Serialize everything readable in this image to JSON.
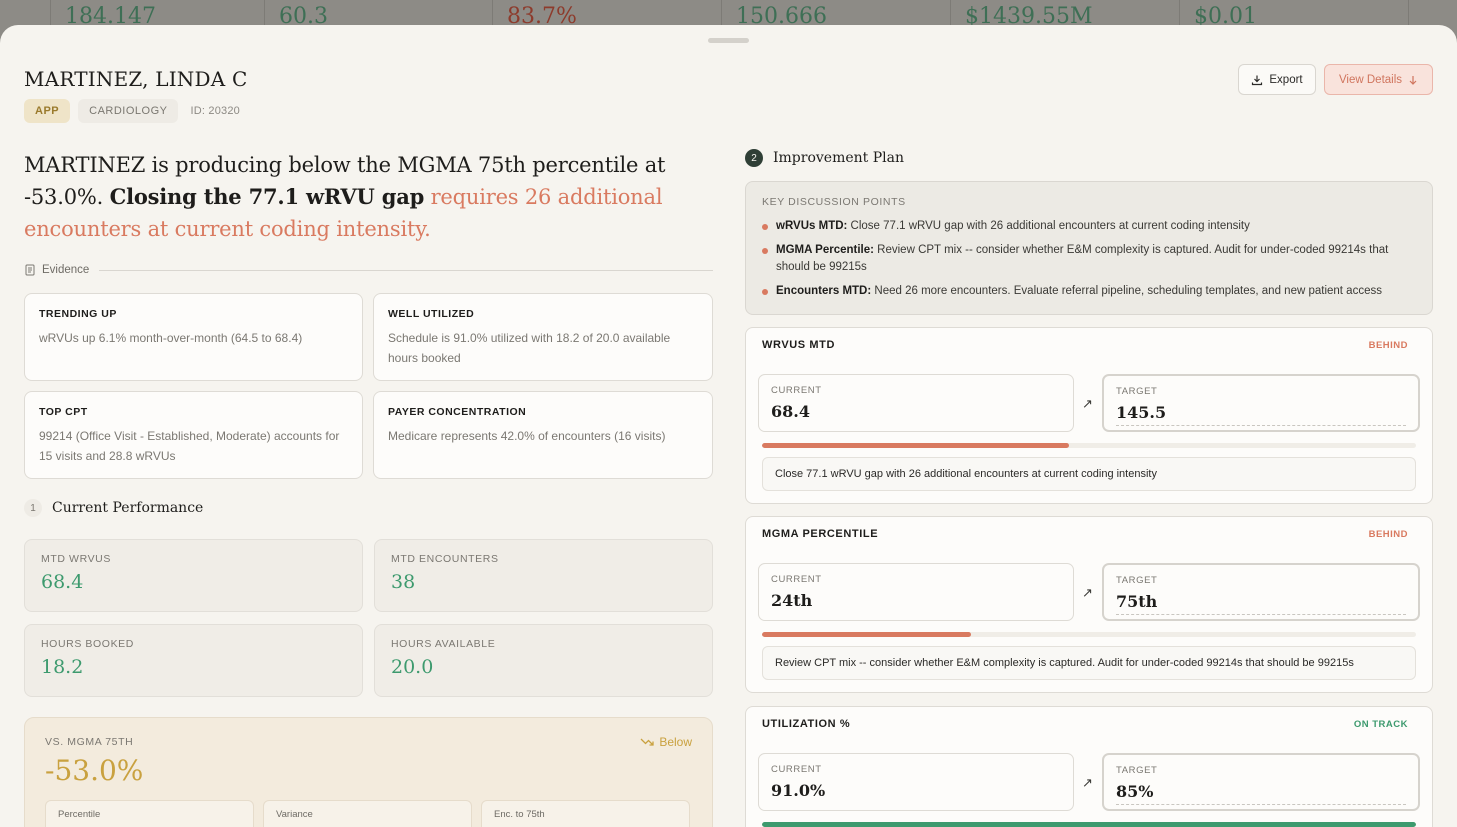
{
  "background_strip": {
    "values": [
      "184.147",
      "60.3",
      "83.7%",
      "150.666",
      "$1439.55M",
      "$0.01"
    ]
  },
  "header": {
    "name": "MARTINEZ, LINDA C",
    "tag_type": "APP",
    "tag_specialty": "CARDIOLOGY",
    "id_label": "ID: 20320",
    "export_label": "Export",
    "view_details_label": "View Details"
  },
  "headline": {
    "part1": "MARTINEZ is producing below the MGMA 75th percentile at -53.0%. ",
    "part2_bold": "Closing the 77.1 wRVU gap",
    "part3_accent": " requires 26 additional encounters at current coding intensity."
  },
  "evidence": {
    "label": "Evidence",
    "cards": [
      {
        "title": "TRENDING UP",
        "text": "wRVUs up 6.1% month-over-month (64.5 to 68.4)"
      },
      {
        "title": "WELL UTILIZED",
        "text": "Schedule is 91.0% utilized with 18.2 of 20.0 available hours booked"
      },
      {
        "title": "TOP CPT",
        "text": "99214 (Office Visit - Established, Moderate) accounts for 15 visits and 28.8 wRVUs"
      },
      {
        "title": "PAYER CONCENTRATION",
        "text": "Medicare represents 42.0% of encounters (16 visits)"
      }
    ]
  },
  "performance": {
    "number": "1",
    "title": "Current Performance",
    "cards": [
      {
        "label": "MTD WRVUS",
        "value": "68.4"
      },
      {
        "label": "MTD ENCOUNTERS",
        "value": "38"
      },
      {
        "label": "HOURS BOOKED",
        "value": "18.2"
      },
      {
        "label": "HOURS AVAILABLE",
        "value": "20.0"
      }
    ],
    "mgma": {
      "label": "VS. MGMA 75TH",
      "value": "-53.0%",
      "trend": "Below",
      "sub_labels": [
        "Percentile",
        "Variance",
        "Enc. to 75th"
      ]
    }
  },
  "plan": {
    "number": "2",
    "title": "Improvement Plan",
    "discussion": {
      "title": "KEY DISCUSSION POINTS",
      "items": [
        {
          "key": "wRVUs MTD:",
          "text": " Close 77.1 wRVU gap with 26 additional encounters at current coding intensity"
        },
        {
          "key": "MGMA Percentile:",
          "text": " Review CPT mix -- consider whether E&M complexity is captured. Audit for under-coded 99214s that should be 99215s"
        },
        {
          "key": "Encounters MTD:",
          "text": " Need 26 more encounters. Evaluate referral pipeline, scheduling templates, and new patient access"
        }
      ]
    },
    "metrics": [
      {
        "name": "WRVUS MTD",
        "status": "BEHIND",
        "current_label": "CURRENT",
        "current": "68.4",
        "target_label": "TARGET",
        "target": "145.5",
        "progress": 0.47,
        "note": "Close 77.1 wRVU gap with 26 additional encounters at current coding intensity"
      },
      {
        "name": "MGMA PERCENTILE",
        "status": "BEHIND",
        "current_label": "CURRENT",
        "current": "24th",
        "target_label": "TARGET",
        "target": "75th",
        "progress": 0.32,
        "note": "Review CPT mix -- consider whether E&M complexity is captured. Audit for under-coded 99214s that should be 99215s"
      },
      {
        "name": "UTILIZATION %",
        "status": "ON TRACK",
        "current_label": "CURRENT",
        "current": "91.0%",
        "target_label": "TARGET",
        "target": "85%",
        "progress": 1.0,
        "note": ""
      }
    ]
  },
  "colors": {
    "accent_red": "#d97a60",
    "accent_green": "#3d9a6e",
    "accent_gold": "#c9a13f"
  }
}
